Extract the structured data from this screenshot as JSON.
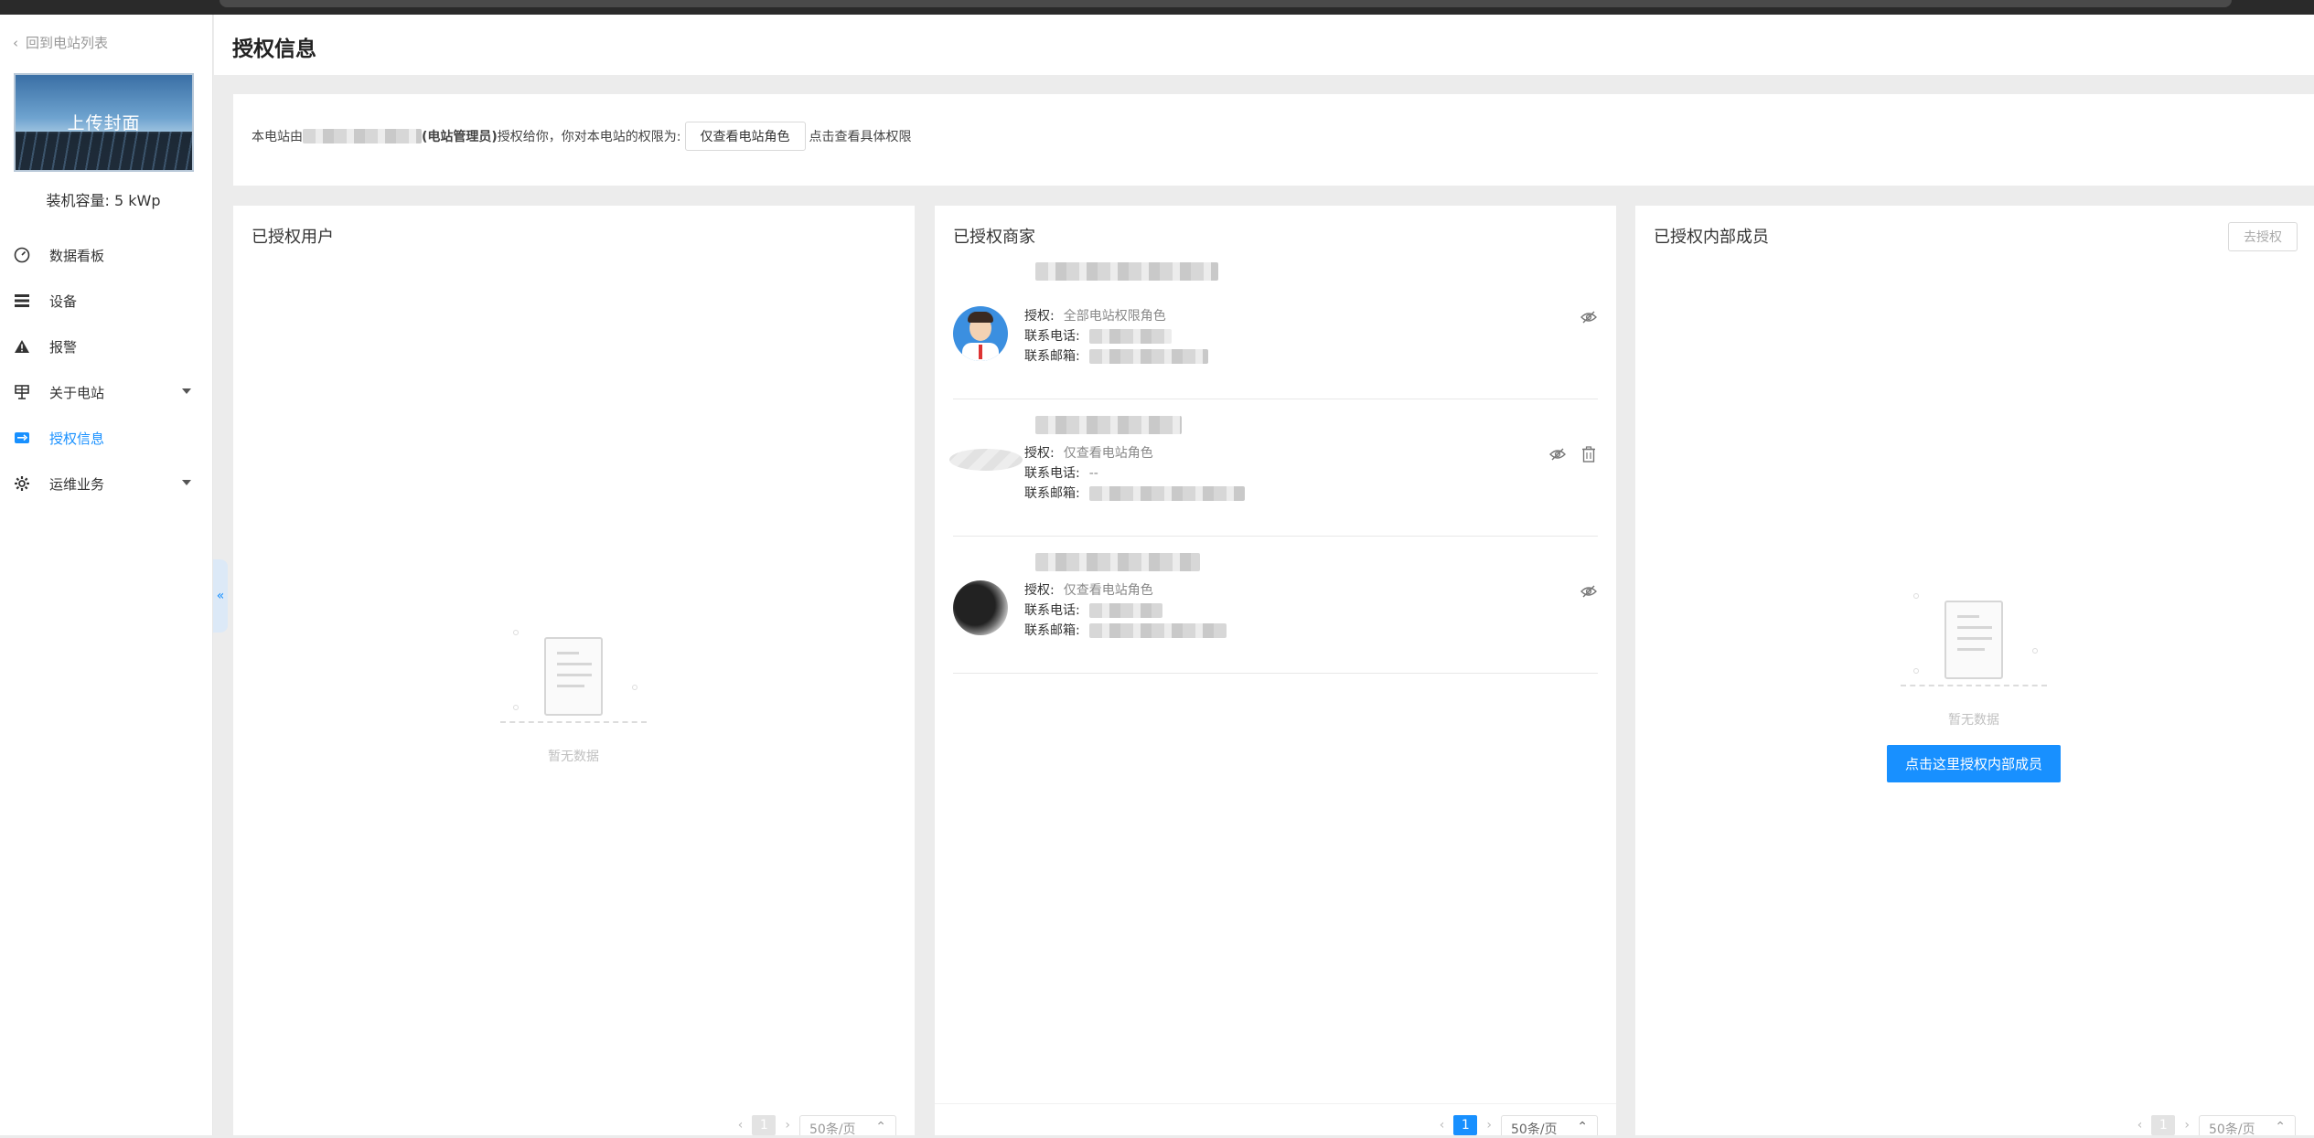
{
  "sidebar": {
    "back_label": "回到电站列表",
    "cover_label": "上传封面",
    "capacity": "装机容量: 5 kWp",
    "items": [
      {
        "label": "数据看板",
        "icon": "dashboard-icon"
      },
      {
        "label": "设备",
        "icon": "list-icon"
      },
      {
        "label": "报警",
        "icon": "warning-icon"
      },
      {
        "label": "关于电站",
        "icon": "station-icon",
        "has_submenu": true
      },
      {
        "label": "授权信息",
        "icon": "authorization-icon",
        "active": true
      },
      {
        "label": "运维业务",
        "icon": "settings-icon",
        "has_submenu": true
      }
    ],
    "collapse_glyph": "«"
  },
  "header": {
    "title": "授权信息"
  },
  "notice": {
    "prefix": "本电站由",
    "role_suffix": "(电站管理员)",
    "middle": "授权给你，你对本电站的权限为:",
    "role_button": "仅查看电站角色",
    "link": "点击查看具体权限"
  },
  "authorized_users": {
    "title": "已授权用户",
    "empty_text": "暂无数据",
    "pager": {
      "page": "1",
      "page_size": "50条/页"
    }
  },
  "authorized_merchants": {
    "title": "已授权商家",
    "items": [
      {
        "auth_label": "授权:",
        "auth_value": "全部电站权限角色",
        "phone_label": "联系电话:",
        "phone_value": "",
        "email_label": "联系邮箱:",
        "email_value": "",
        "can_delete": false
      },
      {
        "auth_label": "授权:",
        "auth_value": "仅查看电站角色",
        "phone_label": "联系电话:",
        "phone_value": "--",
        "email_label": "联系邮箱:",
        "email_value": "",
        "can_delete": true
      },
      {
        "auth_label": "授权:",
        "auth_value": "仅查看电站角色",
        "phone_label": "联系电话:",
        "phone_value": "",
        "email_label": "联系邮箱:",
        "email_value": "",
        "can_delete": false
      }
    ],
    "pager": {
      "page": "1",
      "page_size": "50条/页"
    }
  },
  "internal_members": {
    "title": "已授权内部成员",
    "unauthorize_button": "去授权",
    "empty_text": "暂无数据",
    "cta_button": "点击这里授权内部成员",
    "pager": {
      "page": "1",
      "page_size": "50条/页"
    }
  },
  "colors": {
    "primary": "#1890ff",
    "text": "#333333",
    "muted": "#999999",
    "background": "#ececec"
  }
}
